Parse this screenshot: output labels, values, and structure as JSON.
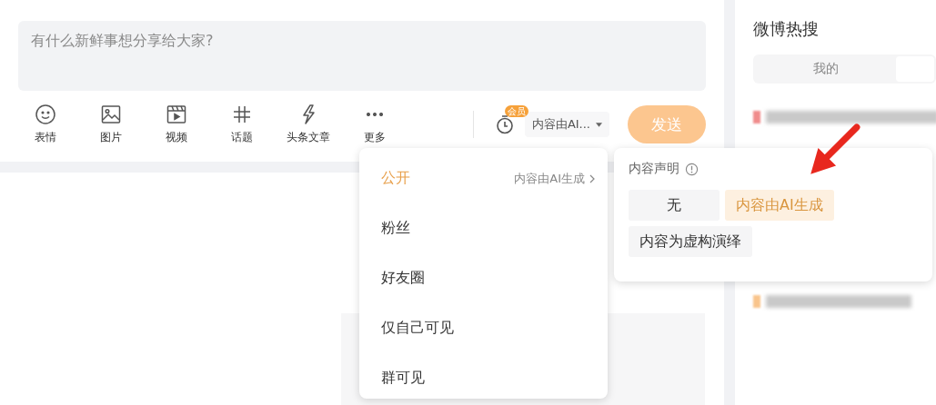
{
  "composer": {
    "placeholder": "有什么新鲜事想分享给大家?"
  },
  "toolbar": [
    {
      "kind": "emoji",
      "label": "表情"
    },
    {
      "kind": "image",
      "label": "图片"
    },
    {
      "kind": "video",
      "label": "视频"
    },
    {
      "kind": "topic",
      "label": "话题"
    },
    {
      "kind": "article",
      "label": "头条文章"
    },
    {
      "kind": "more",
      "label": "更多"
    }
  ],
  "schedule": {
    "badge": "会员"
  },
  "visibility_select": {
    "value": "内容由AI..."
  },
  "send_button": {
    "label": "发送",
    "disabled": true
  },
  "visibility_menu": [
    {
      "label": "公开",
      "selected": true,
      "sub": "内容由AI生成"
    },
    {
      "label": "粉丝",
      "selected": false
    },
    {
      "label": "好友圈",
      "selected": false
    },
    {
      "label": "仅自己可见",
      "selected": false
    },
    {
      "label": "群可见",
      "selected": false
    }
  ],
  "declaration": {
    "title": "内容声明",
    "options": [
      {
        "label": "无",
        "selected": false
      },
      {
        "label": "内容由AI生成",
        "selected": true
      },
      {
        "label": "内容为虚构演绎",
        "selected": false
      }
    ]
  },
  "sidebar": {
    "title": "微博热搜",
    "tabs": [
      {
        "label": "我的",
        "selected": false
      }
    ]
  }
}
